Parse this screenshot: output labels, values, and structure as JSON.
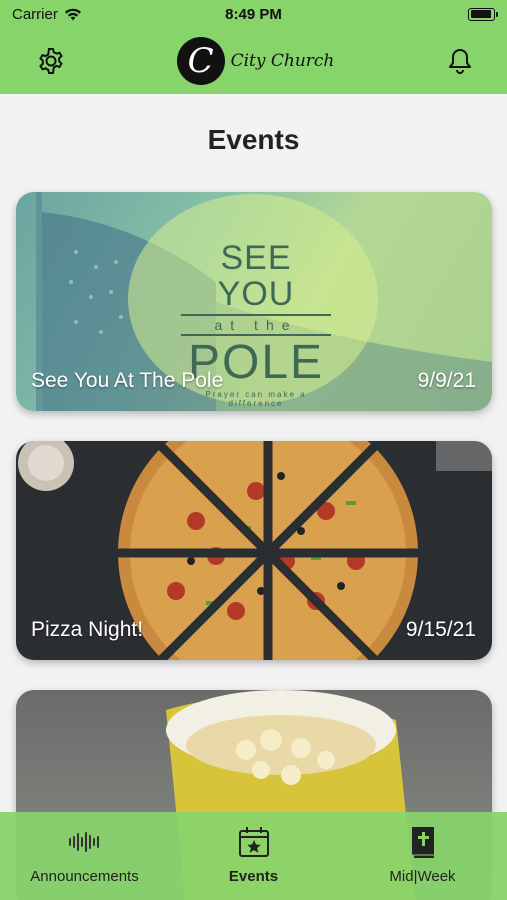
{
  "status_bar": {
    "carrier": "Carrier",
    "time": "8:49 PM",
    "battery_level": 0.95
  },
  "nav": {
    "logo_letter": "C",
    "logo_text": "City Church",
    "settings_icon": "gear-icon",
    "notifications_icon": "bell-icon"
  },
  "page": {
    "title": "Events"
  },
  "events": [
    {
      "title": "See You At The Pole",
      "date": "9/9/21",
      "art": {
        "see_you": "SEE YOU",
        "at_the": "at the",
        "pole": "POLE",
        "tagline": "Prayer can make a difference"
      }
    },
    {
      "title": "Pizza Night!",
      "date": "9/15/21"
    },
    {
      "title": "",
      "date": ""
    }
  ],
  "tabs": [
    {
      "label": "Announcements",
      "icon": "audio-wave-icon",
      "active": false
    },
    {
      "label": "Events",
      "icon": "calendar-star-icon",
      "active": true
    },
    {
      "label": "Mid|Week",
      "icon": "bible-icon",
      "active": false
    }
  ],
  "colors": {
    "brand_green": "#86d46a",
    "text_dark": "#222222",
    "background": "#f2f2f2"
  }
}
